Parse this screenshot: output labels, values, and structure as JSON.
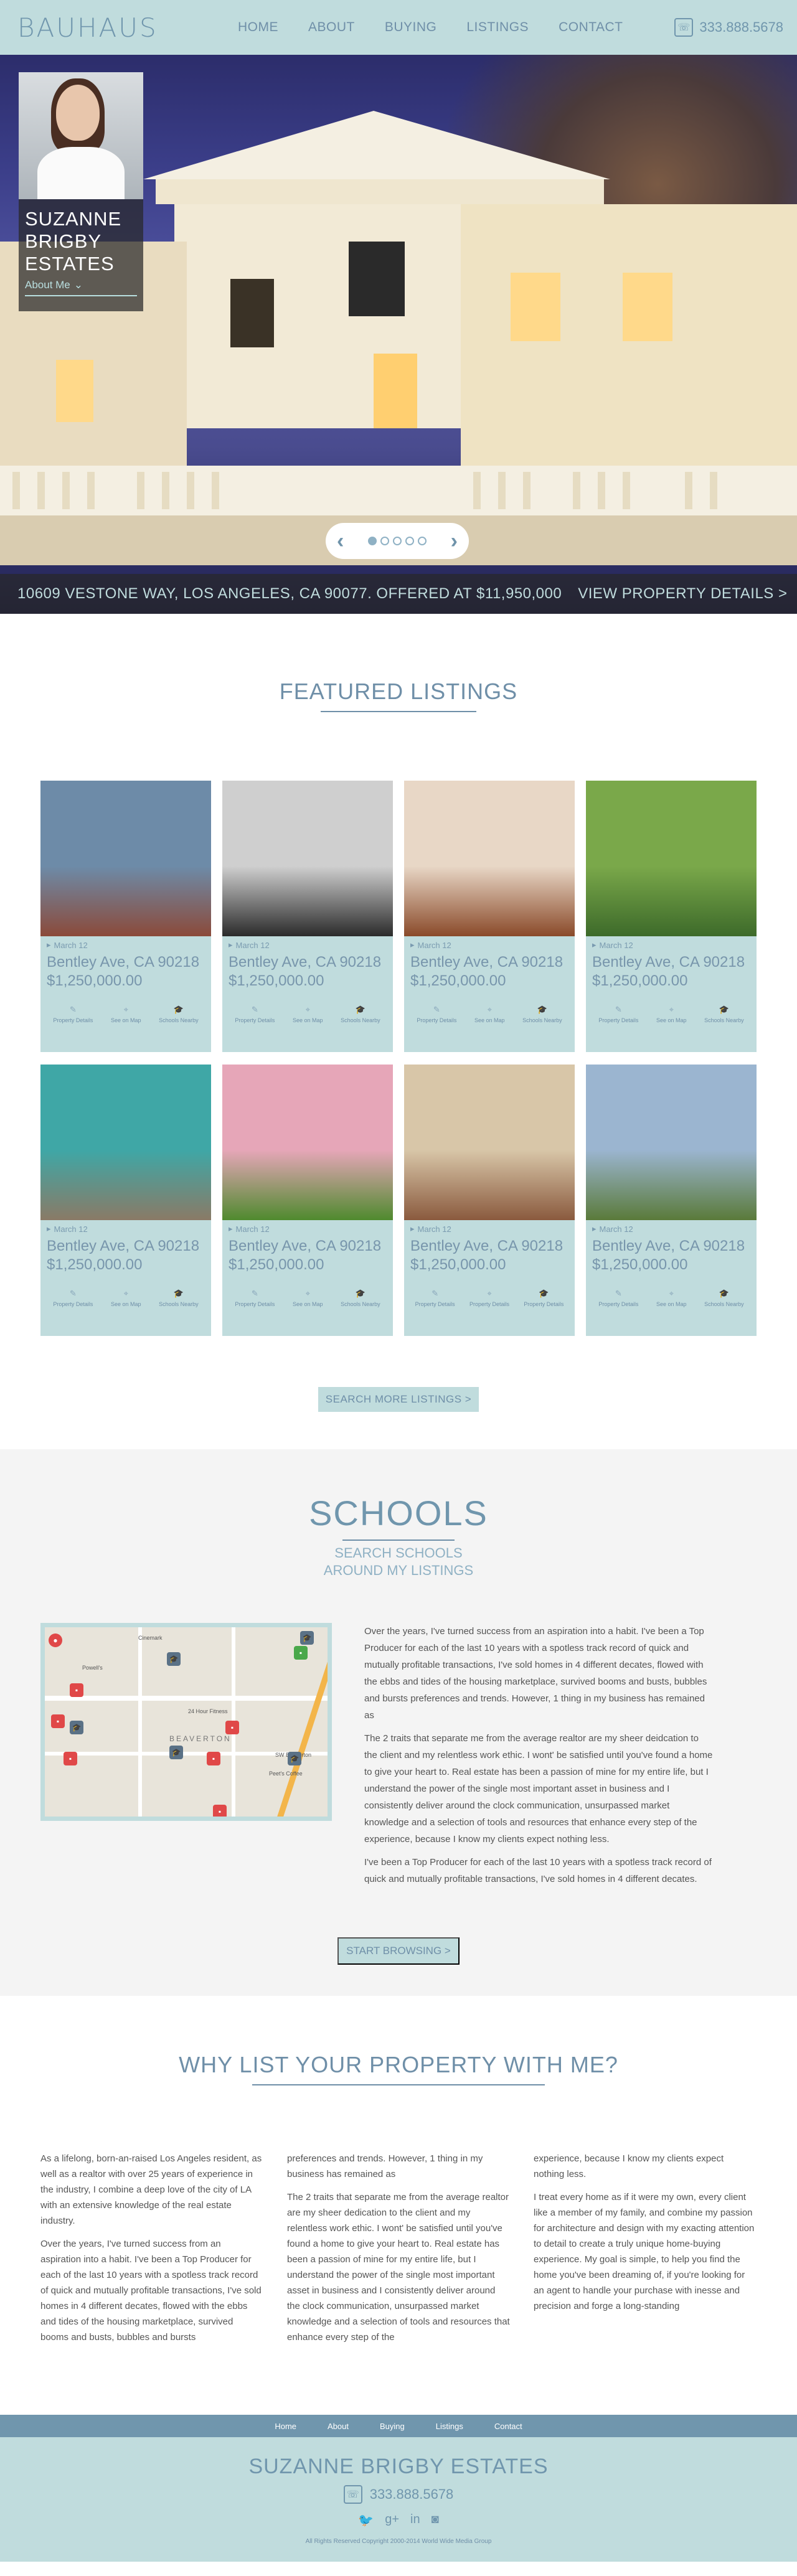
{
  "header": {
    "logo": "BAUHAUS",
    "nav": [
      "HOME",
      "ABOUT",
      "BUYING",
      "LISTINGS",
      "CONTACT"
    ],
    "phone": "333.888.5678",
    "phone_icon": "phone-icon"
  },
  "hero": {
    "agent_name": "SUZANNE BRIGBY ESTATES",
    "about_label": "About Me",
    "address_line": "10609 VESTONE WAY, LOS ANGELES, CA 90077. OFFERED AT $11,950,000",
    "details_link": "VIEW PROPERTY DETAILS >",
    "slides": 5,
    "active_slide": 1
  },
  "featured": {
    "title": "FEATURED LISTINGS",
    "listings": [
      {
        "date": "March 12",
        "address": "Bentley Ave, CA 90218",
        "price": "$1,250,000.00",
        "actions": [
          "Property Details",
          "See on Map",
          "Schools Nearby"
        ],
        "colors": [
          "#6d8ba8",
          "#8b4a3a"
        ]
      },
      {
        "date": "March 12",
        "address": "Bentley Ave, CA 90218",
        "price": "$1,250,000.00",
        "actions": [
          "Property Details",
          "See on Map",
          "Schools Nearby"
        ],
        "colors": [
          "#cfcfcf",
          "#2b2b2b"
        ]
      },
      {
        "date": "March 12",
        "address": "Bentley Ave, CA 90218",
        "price": "$1,250,000.00",
        "actions": [
          "Property Details",
          "See on Map",
          "Schools Nearby"
        ],
        "colors": [
          "#e8d7c6",
          "#8a4a2a"
        ]
      },
      {
        "date": "March 12",
        "address": "Bentley Ave, CA 90218",
        "price": "$1,250,000.00",
        "actions": [
          "Property Details",
          "See on Map",
          "Schools Nearby"
        ],
        "colors": [
          "#7aa84a",
          "#3d6a2a"
        ]
      },
      {
        "date": "March 12",
        "address": "Bentley Ave, CA 90218",
        "price": "$1,250,000.00",
        "actions": [
          "Property Details",
          "See on Map",
          "Schools Nearby"
        ],
        "colors": [
          "#3fa7a6",
          "#8a7a66"
        ]
      },
      {
        "date": "March 12",
        "address": "Bentley Ave, CA 90218",
        "price": "$1,250,000.00",
        "actions": [
          "Property Details",
          "See on Map",
          "Schools Nearby"
        ],
        "colors": [
          "#e6a6b8",
          "#4f8a2e"
        ]
      },
      {
        "date": "March 12",
        "address": "Bentley Ave, CA 90218",
        "price": "$1,250,000.00",
        "actions": [
          "Property Details",
          "Property Details",
          "Property Details"
        ],
        "colors": [
          "#d8c6a8",
          "#8a5a3e"
        ]
      },
      {
        "date": "March 12",
        "address": "Bentley Ave, CA 90218",
        "price": "$1,250,000.00",
        "actions": [
          "Property Details",
          "See on Map",
          "Schools Nearby"
        ],
        "colors": [
          "#9bb5d0",
          "#5a7a3a"
        ]
      }
    ],
    "cta": "SEARCH MORE LISTINGS >"
  },
  "schools": {
    "title": "SCHOOLS",
    "subtitle": "SEARCH SCHOOLS AROUND MY LISTINGS",
    "paragraphs": [
      "Over the years, I've turned success from an aspiration into a habit. I've been a Top Producer for each of the last 10 years with a spotless track record of quick and mutually profitable transactions, I've sold homes in 4 different decates, flowed with the ebbs and tides of the housing marketplace, survived booms and busts, bubbles and bursts preferences and trends. However, 1 thing in my business has remained as",
      "The 2 traits that separate me from the average realtor are my sheer deidcation to the client and my relentless work ethic. I wont' be satisfied until you've found a home to give your heart to. Real estate has been a passion of mine for my entire life, but I understand the power of the single most important asset in business and I consistently deliver around the clock communication, unsurpassed market knowledge and a selection of tools and resources that enhance every step of the experience, because I know my clients expect nothing less.",
      "I've been a Top Producer for each of the last 10 years with a spotless track record of quick and mutually profitable transactions, I've sold homes in 4 different decates."
    ],
    "map_labels": [
      "Cinemark",
      "Powell's",
      "24 Hour Fitness",
      "Peet's Coffee",
      "BEAVERTON",
      "SW Beaverton"
    ],
    "cta": "START BROWSING >"
  },
  "why": {
    "title": "WHY LIST YOUR PROPERTY WITH ME?",
    "columns": [
      [
        "As a lifelong, born-an-raised Los Angeles resident, as well as a realtor with over 25 years of experience in the industry, I combine a deep love of the city of LA with an extensive knowledge of the real estate industry.",
        "Over the years, I've turned success from an aspiration into a habit. I've been a Top Producer for each of the last 10 years with a spotless track record of quick and mutually profitable transactions, I've sold homes in 4 different decates, flowed with the ebbs and tides of the housing marketplace, survived booms and busts, bubbles and bursts"
      ],
      [
        "preferences and trends. However, 1 thing in my business has remained as",
        "The 2 traits that separate me from the average realtor are my sheer dedication to the client and my relentless work ethic. I wont' be satisfied until you've found a home to give your heart to. Real estate has been a passion of mine for my entire life, but I understand the power of the single most important asset in business and I consistently deliver around the clock communication, unsurpassed market knowledge and a selection of tools and resources that enhance every step of the"
      ],
      [
        "experience, because I know my clients expect nothing less.",
        "I treat every home as if it were my own, every client like a member of my family, and combine my passion for architecture and design with my exacting attention to detail to create a truly unique home-buying experience. My goal is simple, to help you find the home you've been dreaming of, if you're looking for an agent to handle your purchase with inesse and precision and forge a long-standing"
      ]
    ]
  },
  "footer": {
    "nav": [
      "Home",
      "About",
      "Buying",
      "Listings",
      "Contact"
    ],
    "name": "SUZANNE BRIGBY ESTATES",
    "phone": "333.888.5678",
    "social": [
      "twitter-icon",
      "google-plus-icon",
      "linkedin-icon",
      "instagram-icon"
    ],
    "copyright": "All Rights Reserved Copyright 2000-2014 World Wide Media Group"
  }
}
